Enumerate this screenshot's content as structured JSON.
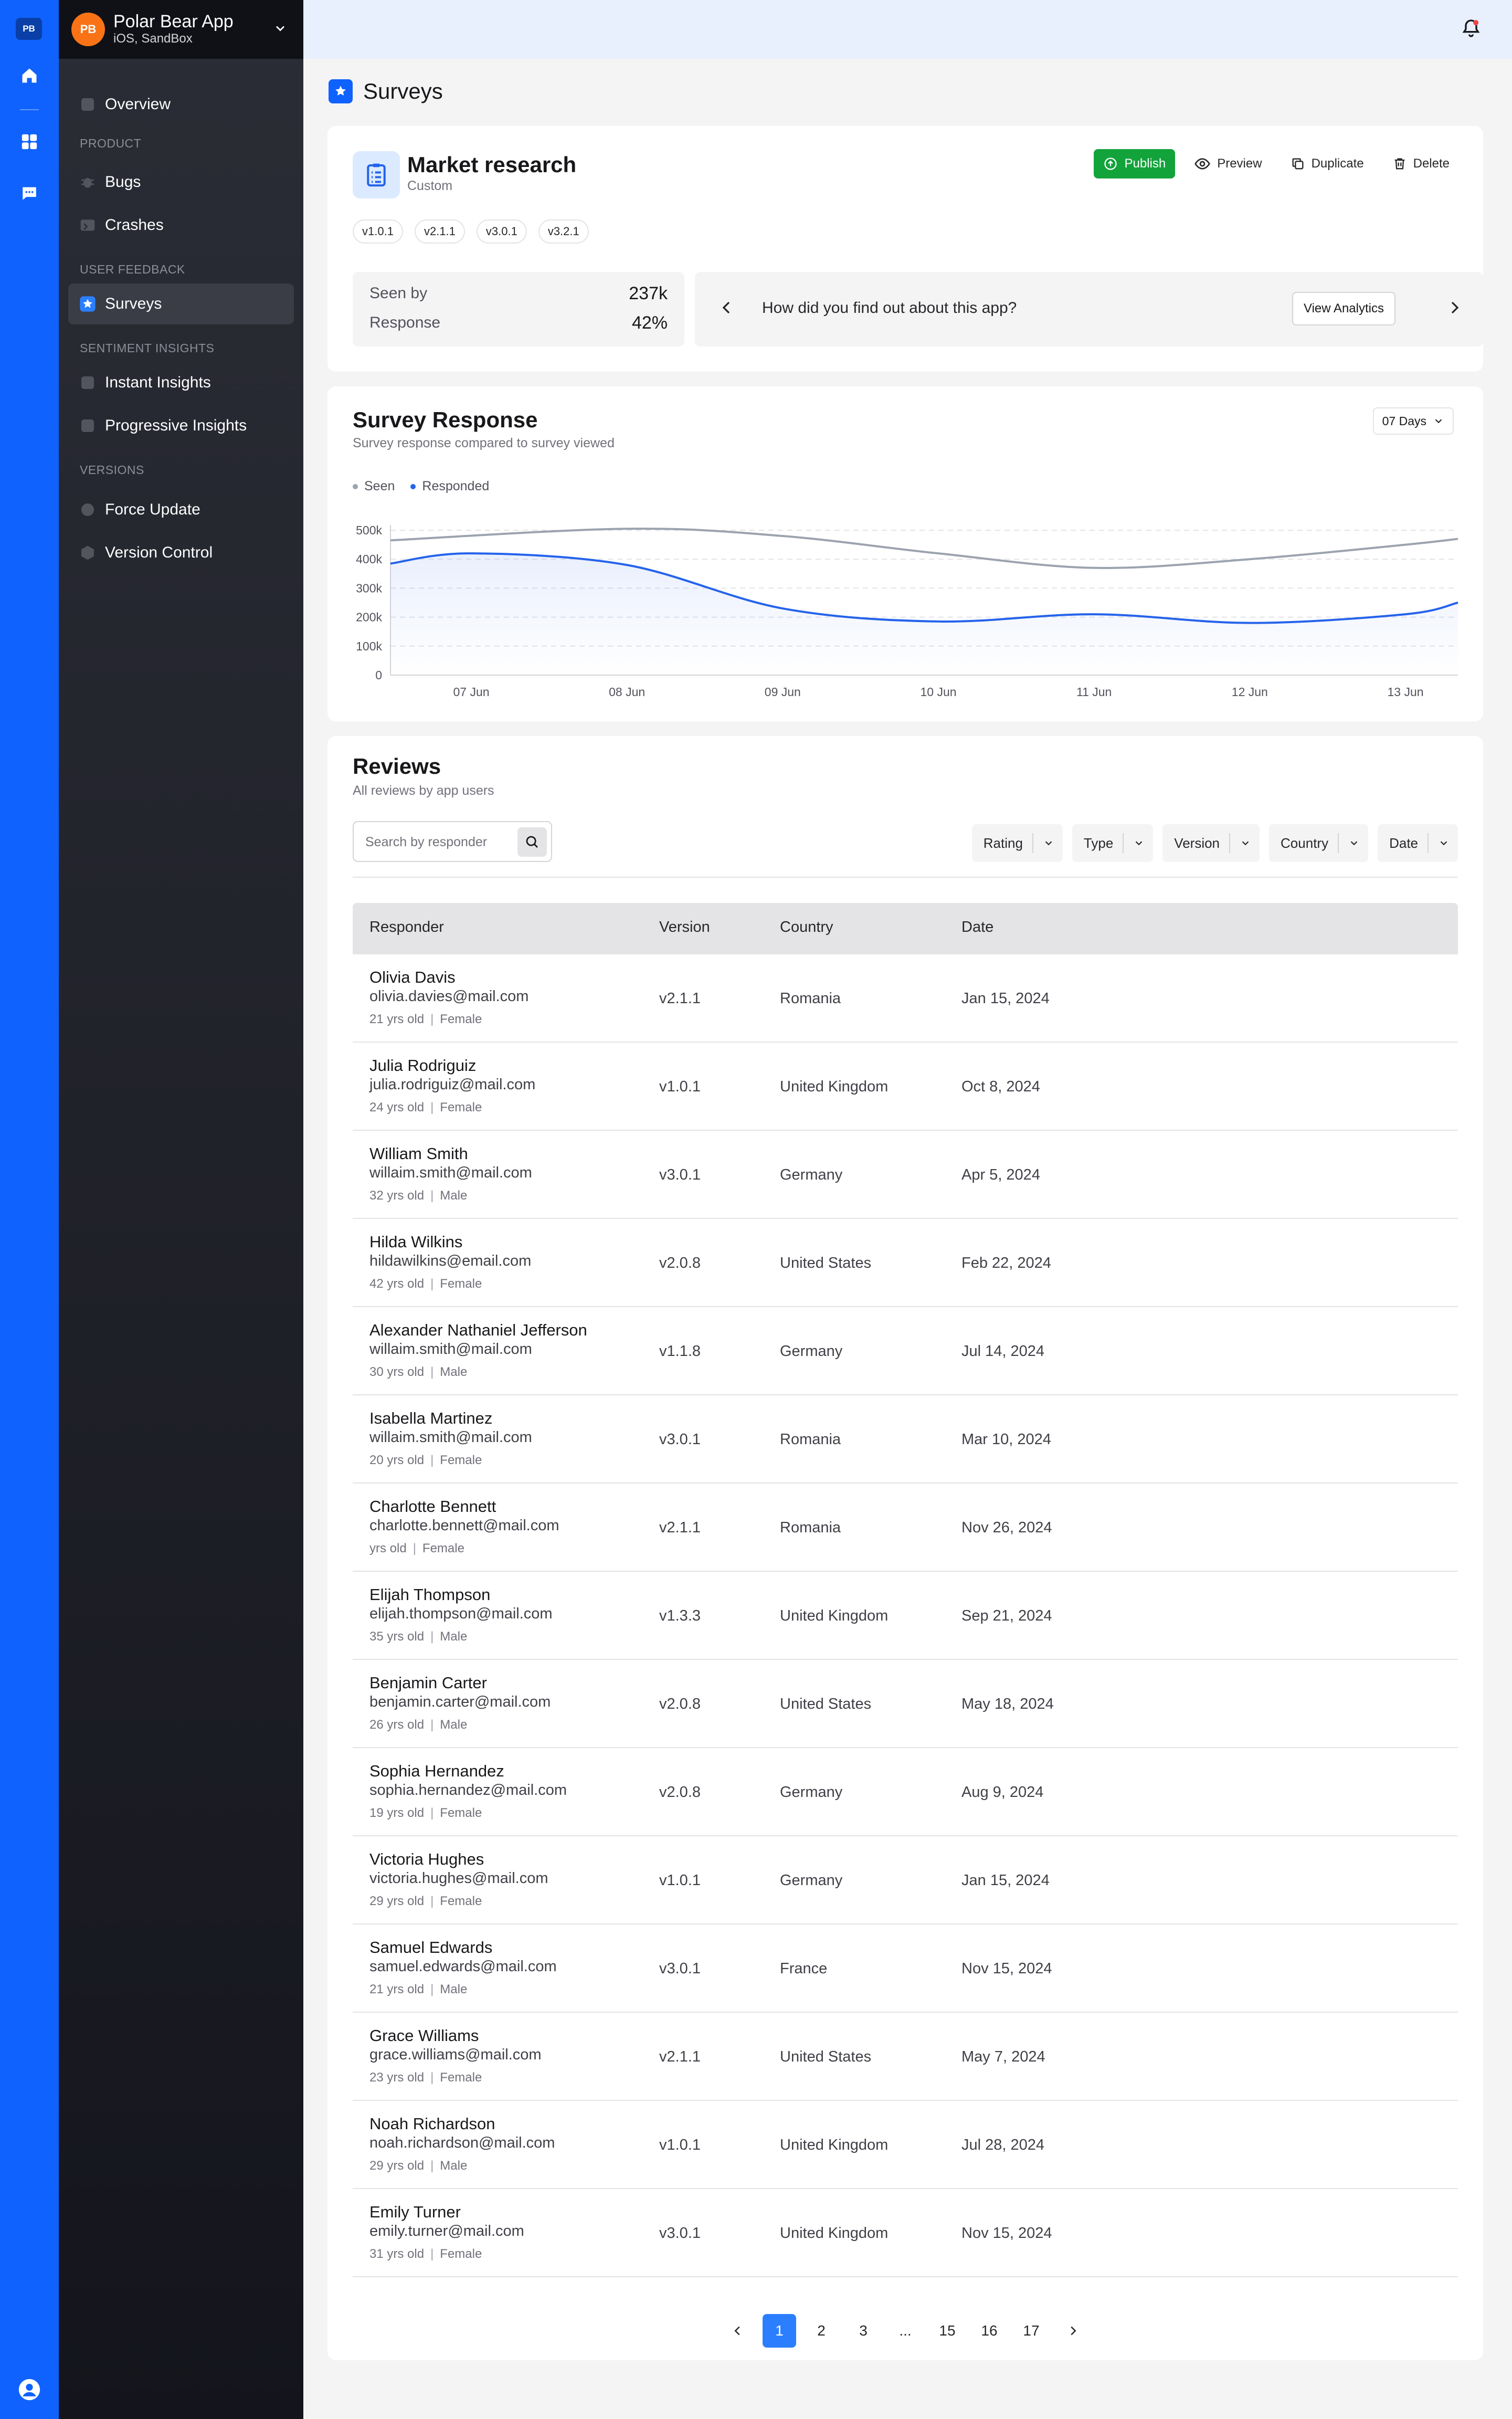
{
  "rail": {
    "logo": "PB"
  },
  "app": {
    "avatar": "PB",
    "name": "Polar Bear App",
    "platform": "iOS, SandBox"
  },
  "nav": {
    "overview": "Overview",
    "product_section": "PRODUCT",
    "bugs": "Bugs",
    "crashes": "Crashes",
    "feedback_section": "USER FEEDBACK",
    "surveys": "Surveys",
    "sentiment_section": "SENTIMENT INSIGHTS",
    "instant": "Instant Insights",
    "progressive": "Progressive Insights",
    "versions_section": "VERSIONS",
    "force_update": "Force Update",
    "version_control": "Version Control"
  },
  "page": {
    "title": "Surveys"
  },
  "survey": {
    "title": "Market research",
    "type": "Custom",
    "actions": {
      "publish": "Publish",
      "preview": "Preview",
      "duplicate": "Duplicate",
      "delete": "Delete"
    },
    "tags": [
      "v1.0.1",
      "v2.1.1",
      "v3.0.1",
      "v3.2.1"
    ],
    "seen_label": "Seen by",
    "seen_value": "237k",
    "response_label": "Response",
    "response_value": "42%",
    "question": "How did you find out about this app?",
    "view_analytics": "View Analytics"
  },
  "chart_card": {
    "title": "Survey Response",
    "subtitle": "Survey response compared to survey viewed",
    "range": "07 Days"
  },
  "chart_data": {
    "type": "line",
    "x": [
      "07 Jun",
      "08 Jun",
      "09 Jun",
      "10 Jun",
      "11 Jun",
      "12 Jun",
      "13 Jun"
    ],
    "y_ticks": [
      "0",
      "100k",
      "200k",
      "300k",
      "400k",
      "500k"
    ],
    "ylim": [
      0,
      500000
    ],
    "grid": true,
    "legend_position": "top-left",
    "series": [
      {
        "name": "Seen",
        "color": "#9ca3af",
        "x": [
          "06.4 Jun",
          "08 Jun",
          "09 Jun",
          "10 Jun",
          "11 Jun",
          "12 Jun",
          "13 Jun",
          "13.5 Jun"
        ],
        "values": [
          465000,
          505000,
          480000,
          420000,
          370000,
          400000,
          450000,
          470000
        ]
      },
      {
        "name": "Responded",
        "color": "#2563eb",
        "x": [
          "06.4 Jun",
          "07 Jun",
          "08 Jun",
          "09 Jun",
          "10 Jun",
          "11 Jun",
          "12 Jun",
          "13 Jun",
          "13.5 Jun"
        ],
        "values": [
          385000,
          420000,
          380000,
          230000,
          185000,
          210000,
          180000,
          210000,
          250000
        ]
      }
    ]
  },
  "reviews": {
    "title": "Reviews",
    "subtitle": "All reviews by app users",
    "search_placeholder": "Search by responder",
    "filters": [
      "Rating",
      "Type",
      "Version",
      "Country",
      "Date"
    ],
    "columns": {
      "responder": "Responder",
      "version": "Version",
      "country": "Country",
      "date": "Date"
    },
    "rows": [
      {
        "name": "Olivia Davis",
        "email": "olivia.davies@mail.com",
        "age": "21 yrs old",
        "gender": "Female",
        "version": "v2.1.1",
        "country": "Romania",
        "date": "Jan 15, 2024"
      },
      {
        "name": "Julia Rodriguiz",
        "email": "julia.rodriguiz@mail.com",
        "age": "24 yrs old",
        "gender": "Female",
        "version": "v1.0.1",
        "country": "United Kingdom",
        "date": "Oct 8, 2024"
      },
      {
        "name": "William Smith",
        "email": "willaim.smith@mail.com",
        "age": "32 yrs old",
        "gender": "Male",
        "version": "v3.0.1",
        "country": "Germany",
        "date": "Apr 5, 2024"
      },
      {
        "name": "Hilda Wilkins",
        "email": "hildawilkins@email.com",
        "age": "42 yrs old",
        "gender": "Female",
        "version": "v2.0.8",
        "country": "United States",
        "date": "Feb 22, 2024"
      },
      {
        "name": "Alexander Nathaniel Jefferson",
        "email": "willaim.smith@mail.com",
        "age": "30 yrs old",
        "gender": "Male",
        "version": "v1.1.8",
        "country": "Germany",
        "date": "Jul 14, 2024"
      },
      {
        "name": "Isabella Martinez",
        "email": "willaim.smith@mail.com",
        "age": "20 yrs old",
        "gender": "Female",
        "version": "v3.0.1",
        "country": "Romania",
        "date": "Mar 10, 2024"
      },
      {
        "name": "Charlotte Bennett",
        "email": "charlotte.bennett@mail.com",
        "age": " yrs old",
        "gender": "Female",
        "version": "v2.1.1",
        "country": "Romania",
        "date": "Nov 26, 2024"
      },
      {
        "name": "Elijah Thompson",
        "email": "elijah.thompson@mail.com",
        "age": "35 yrs old",
        "gender": "Male",
        "version": "v1.3.3",
        "country": "United Kingdom",
        "date": "Sep 21, 2024"
      },
      {
        "name": "Benjamin Carter",
        "email": "benjamin.carter@mail.com",
        "age": "26 yrs old",
        "gender": "Male",
        "version": "v2.0.8",
        "country": "United States",
        "date": "May 18, 2024"
      },
      {
        "name": "Sophia Hernandez",
        "email": "sophia.hernandez@mail.com",
        "age": "19 yrs old",
        "gender": "Female",
        "version": "v2.0.8",
        "country": "Germany",
        "date": "Aug 9, 2024"
      },
      {
        "name": "Victoria Hughes",
        "email": "victoria.hughes@mail.com",
        "age": "29 yrs old",
        "gender": "Female",
        "version": "v1.0.1",
        "country": "Germany",
        "date": "Jan 15, 2024"
      },
      {
        "name": "Samuel Edwards",
        "email": "samuel.edwards@mail.com",
        "age": "21 yrs old",
        "gender": "Male",
        "version": "v3.0.1",
        "country": "France",
        "date": "Nov 15, 2024"
      },
      {
        "name": "Grace Williams",
        "email": "grace.williams@mail.com",
        "age": "23 yrs old",
        "gender": "Female",
        "version": "v2.1.1",
        "country": "United States",
        "date": "May 7, 2024"
      },
      {
        "name": "Noah Richardson",
        "email": "noah.richardson@mail.com",
        "age": "29 yrs old",
        "gender": "Male",
        "version": "v1.0.1",
        "country": "United Kingdom",
        "date": "Jul 28, 2024"
      },
      {
        "name": "Emily Turner",
        "email": "emily.turner@mail.com",
        "age": "31 yrs old",
        "gender": "Female",
        "version": "v3.0.1",
        "country": "United Kingdom",
        "date": "Nov 15, 2024"
      }
    ]
  },
  "pagination": {
    "pages": [
      "1",
      "2",
      "3",
      "...",
      "15",
      "16",
      "17"
    ],
    "current": "1"
  },
  "colors": {
    "brand": "#0f62fe",
    "publish": "#12a33b",
    "avatar": "#f97316",
    "notification": "#ef4444"
  }
}
